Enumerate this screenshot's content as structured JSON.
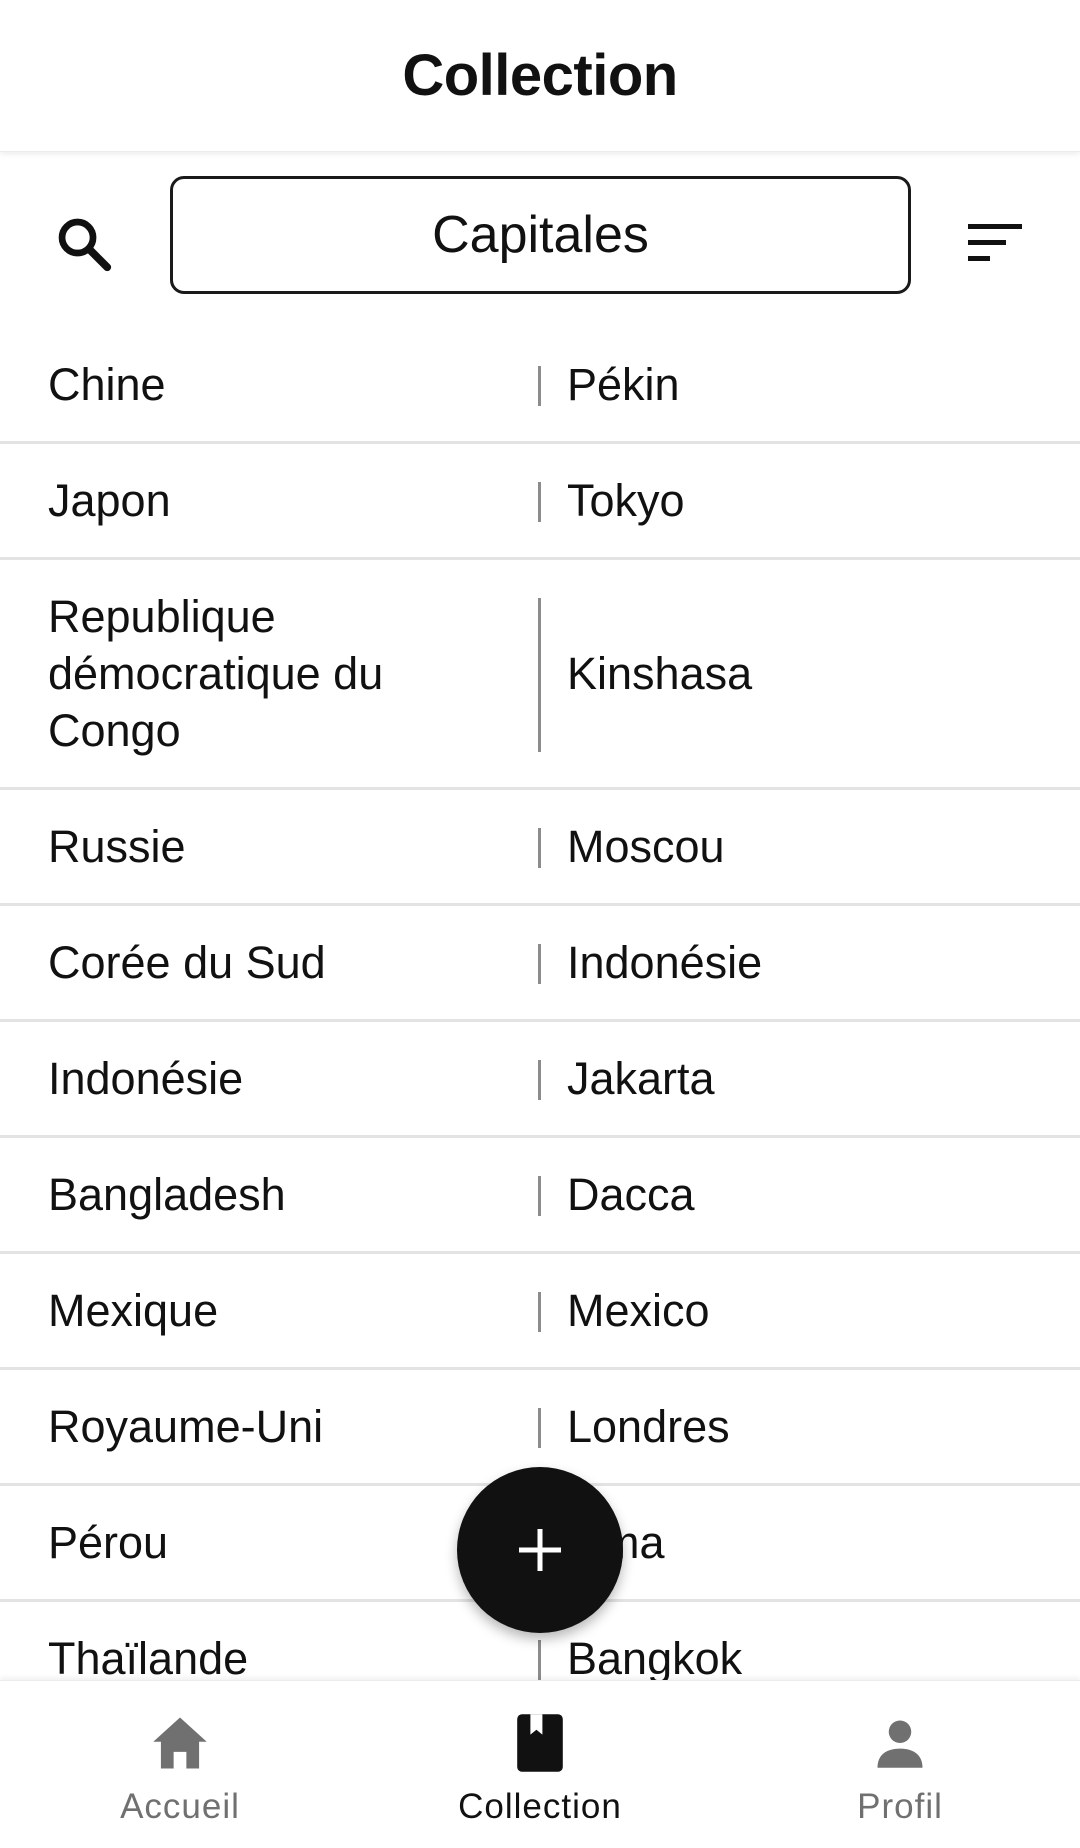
{
  "header": {
    "title": "Collection"
  },
  "toolbar": {
    "search_icon": "search-icon",
    "collection_selected": "Capitales",
    "sort_icon": "sort-icon"
  },
  "rows": [
    {
      "country": "Chine",
      "capital": "Pékin"
    },
    {
      "country": "Japon",
      "capital": "Tokyo"
    },
    {
      "country": "Republique démocratique du Congo",
      "capital": "Kinshasa"
    },
    {
      "country": "Russie",
      "capital": "Moscou"
    },
    {
      "country": "Corée du Sud",
      "capital": "Indonésie"
    },
    {
      "country": "Indonésie",
      "capital": "Jakarta"
    },
    {
      "country": "Bangladesh",
      "capital": "Dacca"
    },
    {
      "country": "Mexique",
      "capital": "Mexico"
    },
    {
      "country": "Royaume-Uni",
      "capital": "Londres"
    },
    {
      "country": "Pérou",
      "capital": "Lima"
    },
    {
      "country": "Thaïlande",
      "capital": "Bangkok"
    }
  ],
  "fab": {
    "icon": "plus-icon"
  },
  "nav": {
    "home": {
      "label": "Accueil",
      "icon": "home-icon"
    },
    "collection": {
      "label": "Collection",
      "icon": "book-icon"
    },
    "profile": {
      "label": "Profil",
      "icon": "person-icon"
    }
  },
  "colors": {
    "text": "#111111",
    "inactive": "#707070",
    "divider": "#e3e3e3",
    "fab": "#111111"
  }
}
